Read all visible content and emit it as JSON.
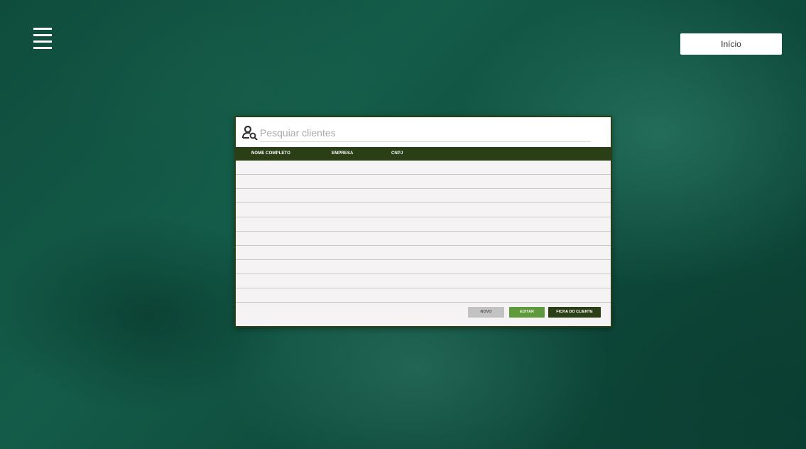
{
  "header": {
    "menu_icon": "hamburger-menu-icon",
    "inicio_label": "Início"
  },
  "search": {
    "icon": "user-search-icon",
    "placeholder": "Pesquiar clientes"
  },
  "table": {
    "columns": [
      "NOME COMPLETO",
      "EMPRESA",
      "CNPJ"
    ],
    "rows": [],
    "empty_row_count": 10
  },
  "actions": {
    "novo_label": "NOVO",
    "editar_label": "EDITAR",
    "ficha_label": "FICHA DO CLIENTE"
  },
  "colors": {
    "header_bg": "#2b3f17",
    "editar_bg": "#5e9a3b",
    "novo_bg": "#c2c2c2",
    "background": "#0f4c3c"
  }
}
